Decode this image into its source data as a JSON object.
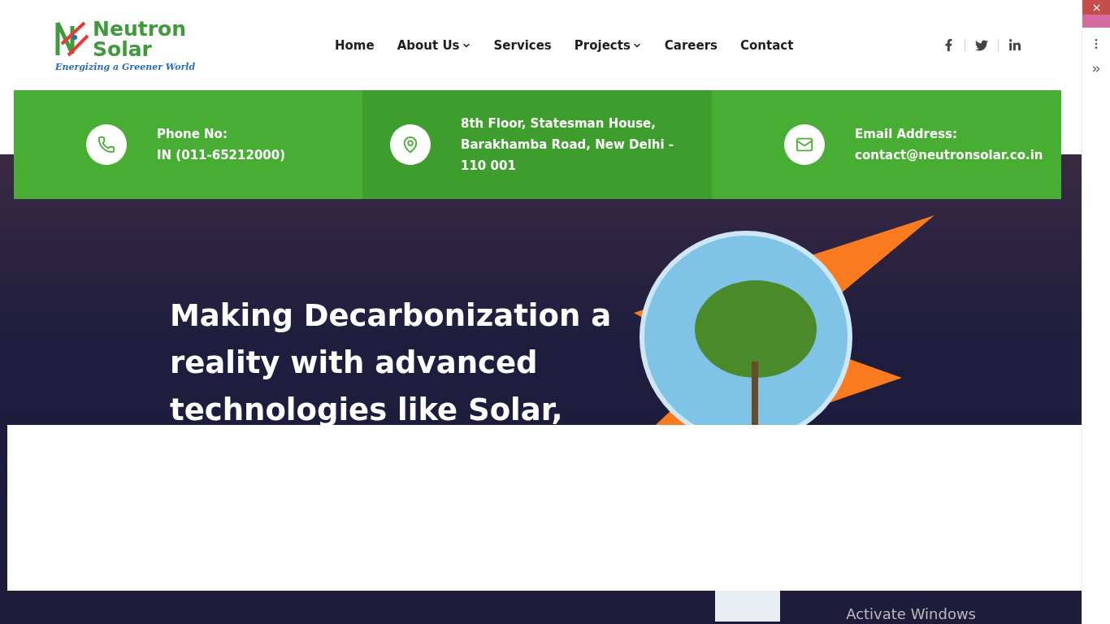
{
  "logo": {
    "line1": "Neutron",
    "line2": "Solar",
    "tagline": "Energizing a Greener World"
  },
  "nav": [
    {
      "label": "Home",
      "dropdown": false
    },
    {
      "label": "About Us",
      "dropdown": true
    },
    {
      "label": "Services",
      "dropdown": false
    },
    {
      "label": "Projects",
      "dropdown": true
    },
    {
      "label": "Careers",
      "dropdown": false
    },
    {
      "label": "Contact",
      "dropdown": false
    }
  ],
  "contact": [
    {
      "kind": "phone",
      "title": "Phone No:",
      "text": "IN (011-65212000)",
      "highlighted": false
    },
    {
      "kind": "location",
      "text": "8th Floor, Statesman House, Barakhamba Road, New Delhi - 110 001",
      "highlighted": true
    },
    {
      "kind": "email",
      "title": "Email Address:",
      "text": "contact@neutronsolar.co.in",
      "highlighted": false
    }
  ],
  "hero": {
    "heading": "Making Decarbonization a reality with advanced technologies like Solar,"
  },
  "os_notice": "Activate Windows"
}
